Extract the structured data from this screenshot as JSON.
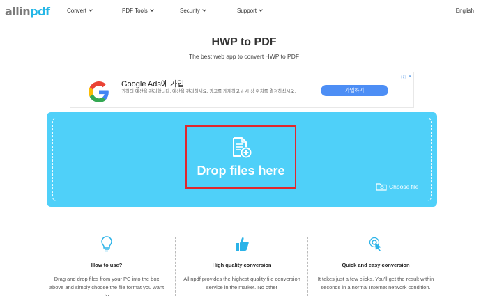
{
  "header": {
    "logo_part1": "allin",
    "logo_part2": "pdf",
    "nav": [
      {
        "label": "Convert"
      },
      {
        "label": "PDF Tools"
      },
      {
        "label": "Security"
      },
      {
        "label": "Support"
      }
    ],
    "language": "English"
  },
  "page": {
    "title": "HWP to PDF",
    "subtitle": "The best web app to convert HWP to PDF"
  },
  "ad": {
    "title": "Google Ads에 가입",
    "description": "귀하의 예산을 관리합니다. 예산을 관리하세요. 광고를 게재하고 # 시 상 위치를 결정하십시오.",
    "button": "가입하기",
    "icon": "google-g-icon"
  },
  "dropzone": {
    "main_text": "Drop files here",
    "choose_label": "Choose file",
    "background": "#4fd0f9",
    "highlight": "#e0282d"
  },
  "features": [
    {
      "icon": "lightbulb-icon",
      "title": "How to use?",
      "description": "Drag and drop files from your PC into the box above and simply choose the file format you want to"
    },
    {
      "icon": "thumbs-up-icon",
      "title": "High quality conversion",
      "description": "Allinpdf provides the highest quality file conversion service in the market. No other"
    },
    {
      "icon": "click-icon",
      "title": "Quick and easy conversion",
      "description": "It takes just a few clicks. You'll get the result within seconds in a normal Internet network condition."
    }
  ]
}
